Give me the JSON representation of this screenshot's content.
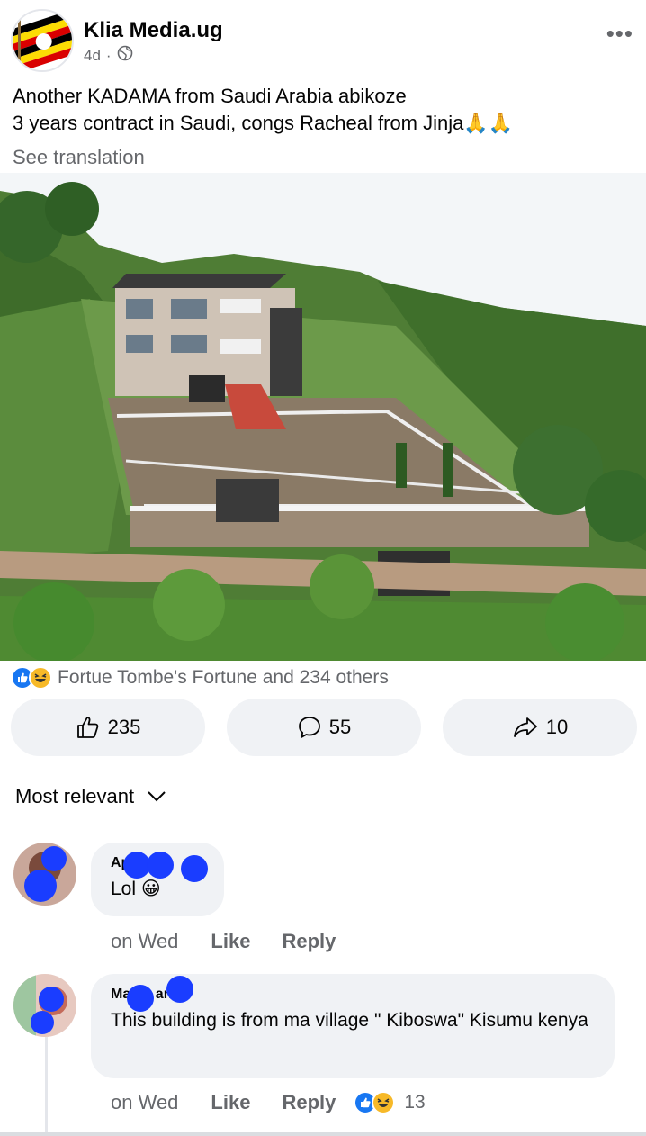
{
  "post": {
    "page_name": "Klia Media.ug",
    "age": "4d",
    "separator": "·",
    "line1": "Another KADAMA from Saudi Arabia abikoze",
    "line2": "3 years contract in Saudi, congs Racheal from Jinja🙏🙏",
    "see_translation": "See translation",
    "more_label": "•••"
  },
  "reactions": {
    "summary": "Fortue Tombe's Fortune and 234 others"
  },
  "actions": {
    "like_count": "235",
    "comment_count": "55",
    "share_count": "10"
  },
  "comments_header": {
    "sort_label": "Most relevant"
  },
  "comments": [
    {
      "author": "Ap      el",
      "text": "Lol 😀",
      "time": "on Wed",
      "like_label": "Like",
      "reply_label": "Reply"
    },
    {
      "author": "Ma    na    ang",
      "text": "This building is from ma village \" Kiboswa\" Kisumu kenya",
      "time": "on Wed",
      "like_label": "Like",
      "reply_label": "Reply",
      "reaction_count": "13"
    }
  ],
  "colors": {
    "accent": "#1877f2",
    "secondary_text": "#65676b",
    "bubble": "#f0f2f5",
    "redaction": "#1a3dff"
  }
}
